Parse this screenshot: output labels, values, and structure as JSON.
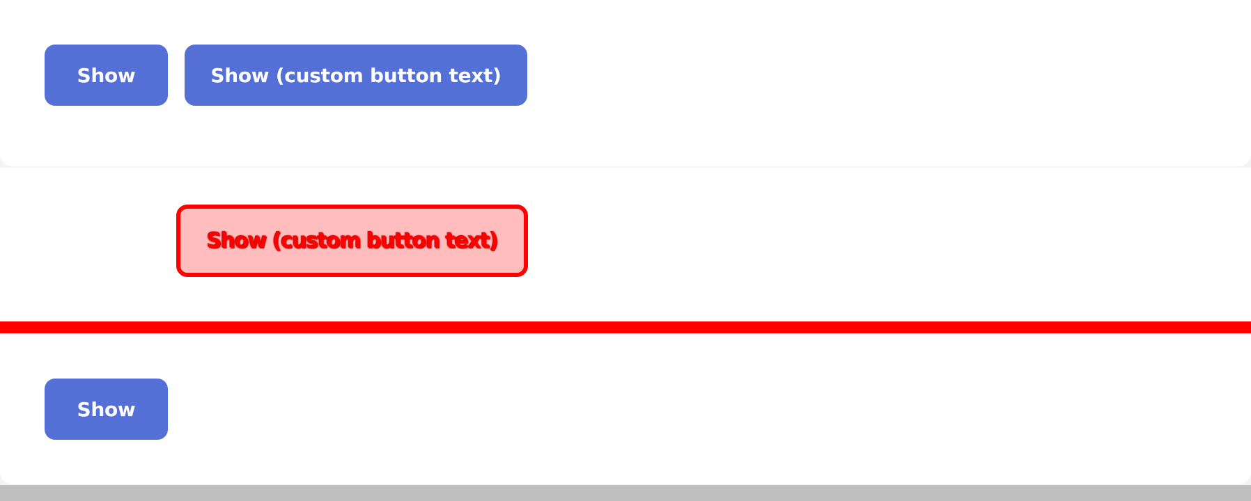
{
  "buttons": {
    "show_label": "Show",
    "show_custom_label": "Show (custom button text)",
    "show_bottom_label": "Show"
  },
  "highlight": {
    "label": "Show (custom button text)"
  },
  "colors": {
    "button_bg": "#5470d6",
    "button_text": "#ffffff",
    "highlight_fill": "#ffbdbd",
    "highlight_border": "#ff0000",
    "divider": "#ff0000",
    "footer": "#bfbfbf"
  }
}
